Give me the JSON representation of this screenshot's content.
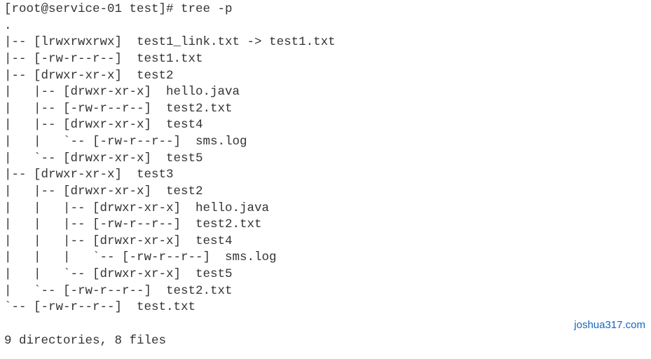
{
  "terminal": {
    "prompt": "[root@service-01 test]# tree -p",
    "lines": [
      ".",
      "|-- [lrwxrwxrwx]  test1_link.txt -> test1.txt",
      "|-- [-rw-r--r--]  test1.txt",
      "|-- [drwxr-xr-x]  test2",
      "|   |-- [drwxr-xr-x]  hello.java",
      "|   |-- [-rw-r--r--]  test2.txt",
      "|   |-- [drwxr-xr-x]  test4",
      "|   |   `-- [-rw-r--r--]  sms.log",
      "|   `-- [drwxr-xr-x]  test5",
      "|-- [drwxr-xr-x]  test3",
      "|   |-- [drwxr-xr-x]  test2",
      "|   |   |-- [drwxr-xr-x]  hello.java",
      "|   |   |-- [-rw-r--r--]  test2.txt",
      "|   |   |-- [drwxr-xr-x]  test4",
      "|   |   |   `-- [-rw-r--r--]  sms.log",
      "|   |   `-- [drwxr-xr-x]  test5",
      "|   `-- [-rw-r--r--]  test2.txt",
      "`-- [-rw-r--r--]  test.txt",
      "",
      "9 directories, 8 files"
    ]
  },
  "watermark": "joshua317.com"
}
